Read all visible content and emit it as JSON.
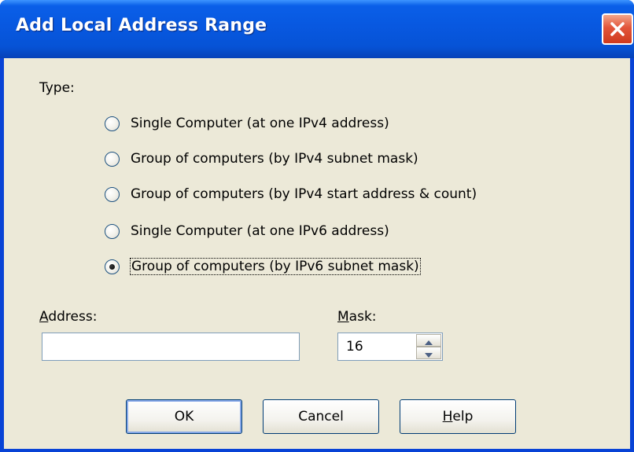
{
  "window": {
    "title": "Add Local Address Range",
    "close_icon": "close-icon"
  },
  "type": {
    "label": "Type:",
    "options": [
      {
        "label": "Single Computer (at one IPv4 address)",
        "selected": false
      },
      {
        "label": "Group of computers (by IPv4 subnet mask)",
        "selected": false
      },
      {
        "label": "Group of computers (by IPv4 start address & count)",
        "selected": false
      },
      {
        "label": "Single Computer (at one IPv6 address)",
        "selected": false
      },
      {
        "label": "Group of computers (by IPv6 subnet mask)",
        "selected": true
      }
    ]
  },
  "address": {
    "label_access_key": "A",
    "label_rest": "ddress:",
    "value": ""
  },
  "mask": {
    "label_access_key": "M",
    "label_rest": "ask:",
    "value": "16"
  },
  "buttons": {
    "ok": "OK",
    "cancel": "Cancel",
    "help_access_key": "H",
    "help_rest": "elp"
  },
  "colors": {
    "title_bar": "#0653d6",
    "client_bg": "#ece9d8",
    "close_button": "#e2553a"
  }
}
